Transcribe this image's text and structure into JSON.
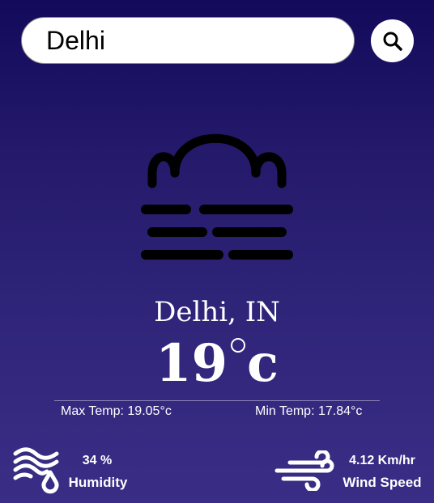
{
  "search": {
    "value": "Delhi",
    "icon": "search-icon"
  },
  "weather": {
    "icon": "fog-icon",
    "city": "Delhi, IN",
    "temp_value": "19",
    "temp_unit": "c",
    "max_temp": "Max Temp: 19.05°c",
    "min_temp": "Min Temp: 17.84°c"
  },
  "humidity": {
    "icon": "humidity-icon",
    "value": "34 %",
    "label": "Humidity"
  },
  "wind": {
    "icon": "wind-icon",
    "value": "4.12 Km/hr",
    "label": "Wind Speed"
  }
}
